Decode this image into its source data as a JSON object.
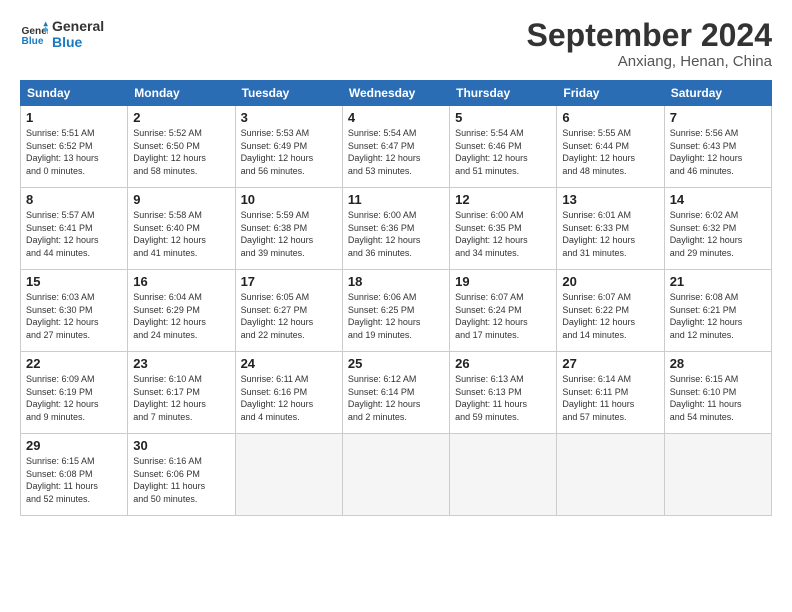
{
  "header": {
    "logo_line1": "General",
    "logo_line2": "Blue",
    "month_title": "September 2024",
    "location": "Anxiang, Henan, China"
  },
  "weekdays": [
    "Sunday",
    "Monday",
    "Tuesday",
    "Wednesday",
    "Thursday",
    "Friday",
    "Saturday"
  ],
  "weeks": [
    [
      {
        "day": "1",
        "lines": [
          "Sunrise: 5:51 AM",
          "Sunset: 6:52 PM",
          "Daylight: 13 hours",
          "and 0 minutes."
        ]
      },
      {
        "day": "2",
        "lines": [
          "Sunrise: 5:52 AM",
          "Sunset: 6:50 PM",
          "Daylight: 12 hours",
          "and 58 minutes."
        ]
      },
      {
        "day": "3",
        "lines": [
          "Sunrise: 5:53 AM",
          "Sunset: 6:49 PM",
          "Daylight: 12 hours",
          "and 56 minutes."
        ]
      },
      {
        "day": "4",
        "lines": [
          "Sunrise: 5:54 AM",
          "Sunset: 6:47 PM",
          "Daylight: 12 hours",
          "and 53 minutes."
        ]
      },
      {
        "day": "5",
        "lines": [
          "Sunrise: 5:54 AM",
          "Sunset: 6:46 PM",
          "Daylight: 12 hours",
          "and 51 minutes."
        ]
      },
      {
        "day": "6",
        "lines": [
          "Sunrise: 5:55 AM",
          "Sunset: 6:44 PM",
          "Daylight: 12 hours",
          "and 48 minutes."
        ]
      },
      {
        "day": "7",
        "lines": [
          "Sunrise: 5:56 AM",
          "Sunset: 6:43 PM",
          "Daylight: 12 hours",
          "and 46 minutes."
        ]
      }
    ],
    [
      {
        "day": "8",
        "lines": [
          "Sunrise: 5:57 AM",
          "Sunset: 6:41 PM",
          "Daylight: 12 hours",
          "and 44 minutes."
        ]
      },
      {
        "day": "9",
        "lines": [
          "Sunrise: 5:58 AM",
          "Sunset: 6:40 PM",
          "Daylight: 12 hours",
          "and 41 minutes."
        ]
      },
      {
        "day": "10",
        "lines": [
          "Sunrise: 5:59 AM",
          "Sunset: 6:38 PM",
          "Daylight: 12 hours",
          "and 39 minutes."
        ]
      },
      {
        "day": "11",
        "lines": [
          "Sunrise: 6:00 AM",
          "Sunset: 6:36 PM",
          "Daylight: 12 hours",
          "and 36 minutes."
        ]
      },
      {
        "day": "12",
        "lines": [
          "Sunrise: 6:00 AM",
          "Sunset: 6:35 PM",
          "Daylight: 12 hours",
          "and 34 minutes."
        ]
      },
      {
        "day": "13",
        "lines": [
          "Sunrise: 6:01 AM",
          "Sunset: 6:33 PM",
          "Daylight: 12 hours",
          "and 31 minutes."
        ]
      },
      {
        "day": "14",
        "lines": [
          "Sunrise: 6:02 AM",
          "Sunset: 6:32 PM",
          "Daylight: 12 hours",
          "and 29 minutes."
        ]
      }
    ],
    [
      {
        "day": "15",
        "lines": [
          "Sunrise: 6:03 AM",
          "Sunset: 6:30 PM",
          "Daylight: 12 hours",
          "and 27 minutes."
        ]
      },
      {
        "day": "16",
        "lines": [
          "Sunrise: 6:04 AM",
          "Sunset: 6:29 PM",
          "Daylight: 12 hours",
          "and 24 minutes."
        ]
      },
      {
        "day": "17",
        "lines": [
          "Sunrise: 6:05 AM",
          "Sunset: 6:27 PM",
          "Daylight: 12 hours",
          "and 22 minutes."
        ]
      },
      {
        "day": "18",
        "lines": [
          "Sunrise: 6:06 AM",
          "Sunset: 6:25 PM",
          "Daylight: 12 hours",
          "and 19 minutes."
        ]
      },
      {
        "day": "19",
        "lines": [
          "Sunrise: 6:07 AM",
          "Sunset: 6:24 PM",
          "Daylight: 12 hours",
          "and 17 minutes."
        ]
      },
      {
        "day": "20",
        "lines": [
          "Sunrise: 6:07 AM",
          "Sunset: 6:22 PM",
          "Daylight: 12 hours",
          "and 14 minutes."
        ]
      },
      {
        "day": "21",
        "lines": [
          "Sunrise: 6:08 AM",
          "Sunset: 6:21 PM",
          "Daylight: 12 hours",
          "and 12 minutes."
        ]
      }
    ],
    [
      {
        "day": "22",
        "lines": [
          "Sunrise: 6:09 AM",
          "Sunset: 6:19 PM",
          "Daylight: 12 hours",
          "and 9 minutes."
        ]
      },
      {
        "day": "23",
        "lines": [
          "Sunrise: 6:10 AM",
          "Sunset: 6:17 PM",
          "Daylight: 12 hours",
          "and 7 minutes."
        ]
      },
      {
        "day": "24",
        "lines": [
          "Sunrise: 6:11 AM",
          "Sunset: 6:16 PM",
          "Daylight: 12 hours",
          "and 4 minutes."
        ]
      },
      {
        "day": "25",
        "lines": [
          "Sunrise: 6:12 AM",
          "Sunset: 6:14 PM",
          "Daylight: 12 hours",
          "and 2 minutes."
        ]
      },
      {
        "day": "26",
        "lines": [
          "Sunrise: 6:13 AM",
          "Sunset: 6:13 PM",
          "Daylight: 11 hours",
          "and 59 minutes."
        ]
      },
      {
        "day": "27",
        "lines": [
          "Sunrise: 6:14 AM",
          "Sunset: 6:11 PM",
          "Daylight: 11 hours",
          "and 57 minutes."
        ]
      },
      {
        "day": "28",
        "lines": [
          "Sunrise: 6:15 AM",
          "Sunset: 6:10 PM",
          "Daylight: 11 hours",
          "and 54 minutes."
        ]
      }
    ],
    [
      {
        "day": "29",
        "lines": [
          "Sunrise: 6:15 AM",
          "Sunset: 6:08 PM",
          "Daylight: 11 hours",
          "and 52 minutes."
        ]
      },
      {
        "day": "30",
        "lines": [
          "Sunrise: 6:16 AM",
          "Sunset: 6:06 PM",
          "Daylight: 11 hours",
          "and 50 minutes."
        ]
      },
      {
        "day": "",
        "lines": []
      },
      {
        "day": "",
        "lines": []
      },
      {
        "day": "",
        "lines": []
      },
      {
        "day": "",
        "lines": []
      },
      {
        "day": "",
        "lines": []
      }
    ]
  ]
}
